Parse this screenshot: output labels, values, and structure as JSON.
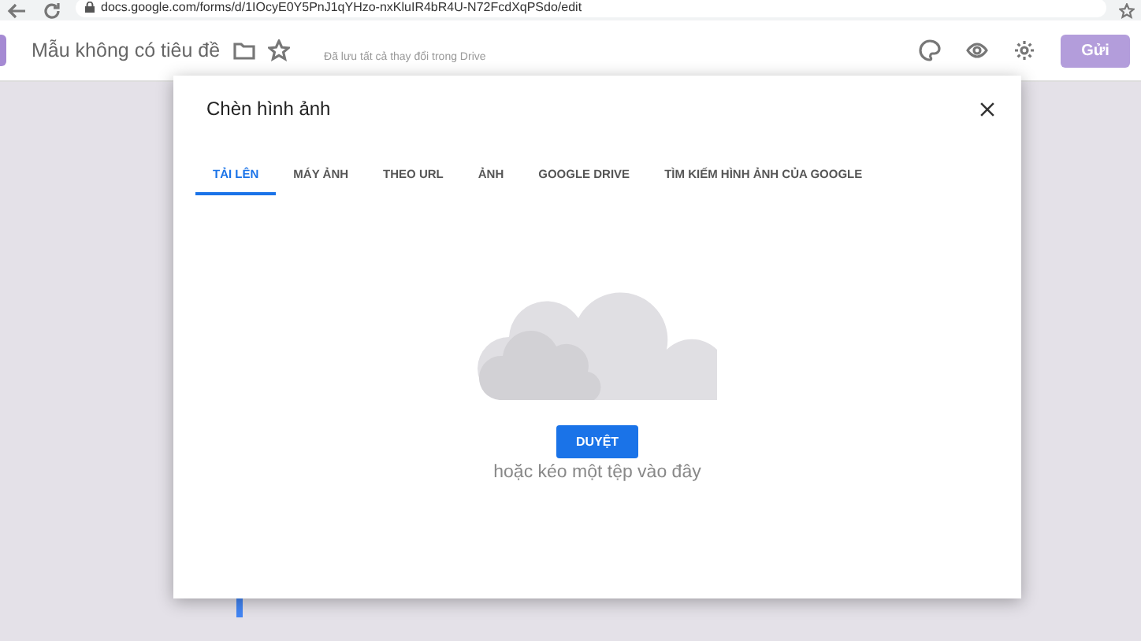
{
  "browser": {
    "url": "docs.google.com/forms/d/1IOcyE0Y5PnJ1qYHzo-nxKluIR4bR4U-N72FcdXqPSdo/edit"
  },
  "header": {
    "title": "Mẫu không có tiêu đề",
    "save_status": "Đã lưu tất cả thay đổi trong Drive",
    "send_button": "Gửi"
  },
  "dialog": {
    "title": "Chèn hình ảnh",
    "tabs": [
      {
        "label": "TẢI LÊN",
        "selected": true
      },
      {
        "label": "MÁY ẢNH",
        "selected": false
      },
      {
        "label": "THEO URL",
        "selected": false
      },
      {
        "label": "ẢNH",
        "selected": false
      },
      {
        "label": "GOOGLE DRIVE",
        "selected": false
      },
      {
        "label": "TÌM KIẾM HÌNH ẢNH CỦA GOOGLE",
        "selected": false
      }
    ],
    "browse_button": "DUYỆT",
    "drop_hint": "hoặc kéo một tệp vào đây"
  }
}
